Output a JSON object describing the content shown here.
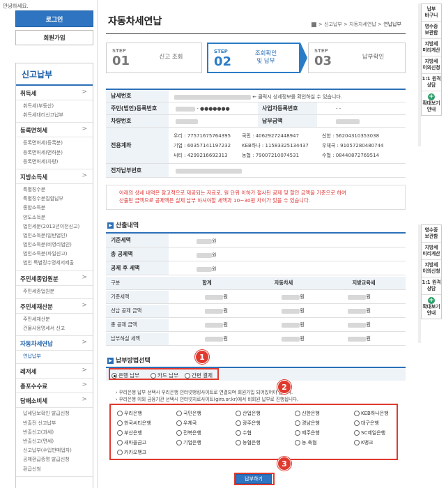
{
  "greeting": "안녕하세요.",
  "login": "로그인",
  "join": "회원가입",
  "lnb": {
    "title": "신고납부",
    "groups": [
      {
        "label": "취득세",
        "chev": ">",
        "subs": [
          "취득세(부동산)",
          "취득세대리신고납부"
        ]
      },
      {
        "label": "등록면허세",
        "chev": ">",
        "subs": [
          "등록면허세(등록분)",
          "등록면허세(면허분)",
          "등록면허세(차량)"
        ]
      },
      {
        "label": "지방소득세",
        "chev": ">",
        "subs": [
          "특별징수분",
          "특별징수분집합납부",
          "종합소득분",
          "양도소득분",
          "법인세분(2013년이전신고)",
          "법인소득분(일반법인)",
          "법인소득분(비영리법인)",
          "법인소득분(파일신고)",
          "법인 특별징수명세서제출"
        ]
      },
      {
        "label": "주민세종업원분",
        "chev": ">",
        "subs": [
          "주민세종업원분"
        ]
      },
      {
        "label": "주민세재산분",
        "chev": ">",
        "subs": [
          "주민세재산분",
          "건물사용명세서 신고"
        ]
      },
      {
        "label": "자동차세연납",
        "chev": ">",
        "subs": [
          "연납납부"
        ]
      },
      {
        "label": "레저세",
        "chev": ">",
        "subs": []
      },
      {
        "label": "총포수수료",
        "chev": ">",
        "subs": []
      },
      {
        "label": "담배소비세",
        "chev": ">",
        "subs": [
          "납세담보확인 발급신청",
          "반출전 신고납부",
          "반출신고(과세)",
          "반출신고(면세)",
          "신고납부(수입판매업자)",
          "공제환급증명 발급신청",
          "환급신청"
        ]
      }
    ]
  },
  "page": {
    "title": "자동차세연납",
    "breadcrumb": [
      "신고납부",
      "자동차세연납",
      "연납납부"
    ],
    "breadcrumb_sep": ">"
  },
  "steps": [
    {
      "step": "STEP",
      "num": "01",
      "label": "신고 조회"
    },
    {
      "step": "STEP",
      "num": "02",
      "label": "조회확인\n및 납부"
    },
    {
      "step": "STEP",
      "num": "03",
      "label": "납부확인"
    }
  ],
  "info": {
    "tax_no_label": "납세번호",
    "tax_no_hint": "← 클릭시 상세정보를 확인하실 수 있습니다.",
    "reg_no_label": "주민(법인)등록번호",
    "reg_no_mask": "- ●●●●●●●",
    "biz_no_label": "사업자등록번호",
    "biz_no_value": "- -",
    "car_no_label": "차량번호",
    "amount_label": "납부금액",
    "account_label": "전용계좌",
    "accounts": [
      [
        "우리 : 77571675764395",
        "국민 : 40629272448947",
        "신한 : 56204310353038"
      ],
      [
        "기업 : 60357141197232",
        "KEB하나 : 11583325134437",
        "우체국 : 91057280480744"
      ],
      [
        "씨티 : 4299216692313",
        "농협 : 79007210074531",
        "수협 : 08440872769514"
      ]
    ],
    "epay_label": "전자납부번호"
  },
  "notice": {
    "line1": "아래의 상세 내역은 참고적으로 제공되는 자료로, 원 단위 이하가 절사된 공제 및 할인 금액을 기준으로 하여",
    "line2": "산출된 금액으로 공제액은 실제 납부 하셔야할 세액과 10~30원 차이가 있을 수 있습니다."
  },
  "calc": {
    "section_title": "산출내역",
    "base_label": "기준세액",
    "deduct_label": "총 공제액",
    "after_label": "공제 후 세액",
    "unit": "원",
    "headers": [
      "구분",
      "합계",
      "자동차세",
      "지방교육세"
    ],
    "rows": [
      "기준세액",
      "선납 공제 금액",
      "총 공제 금액",
      "납부하실 세액"
    ]
  },
  "payment": {
    "section_title": "납부방법선택",
    "options": [
      "은행 납부",
      "카드 납부",
      "간편 결제"
    ],
    "notes": [
      "우리은행 납부 선택시 우리은행 인터넷뱅킹사이트로 연결되며 회원가입 되어있어야 합니다.",
      "우리은행 이외 금융기관 선택시 인터넷지로사이트(giro.or.kr)에서 비회원 납부로 진행됩니다."
    ],
    "banks": [
      "우리은행",
      "국민은행",
      "산업은행",
      "신한은행",
      "KEB하나은행",
      "한국씨티은행",
      "우체국",
      "광주은행",
      "경남은행",
      "대구은행",
      "부산은행",
      "전북은행",
      "수협",
      "제주은행",
      "SC제일은행",
      "새마을금고",
      "기업은행",
      "농협은행",
      "농.축협",
      "K뱅크",
      "카카오뱅크"
    ],
    "pay_button": "납부하기"
  },
  "callouts": [
    "1",
    "2",
    "3"
  ],
  "quick_top": [
    "납부\n바구니",
    "영수증\n보관함",
    "지방세\n미리계산",
    "지방세\n이의신청",
    "1:1 원격\n상담",
    "확대보기\n안내"
  ],
  "quick_bottom": [
    "영수증\n보관함",
    "지방세\n미리계산",
    "지방세\n이의신청",
    "1:1 원격\n상담",
    "확대보기\n안내"
  ],
  "colors": {
    "accent": "#2b6fb8",
    "callout": "#e03a2f",
    "notice": "#dd3333"
  }
}
